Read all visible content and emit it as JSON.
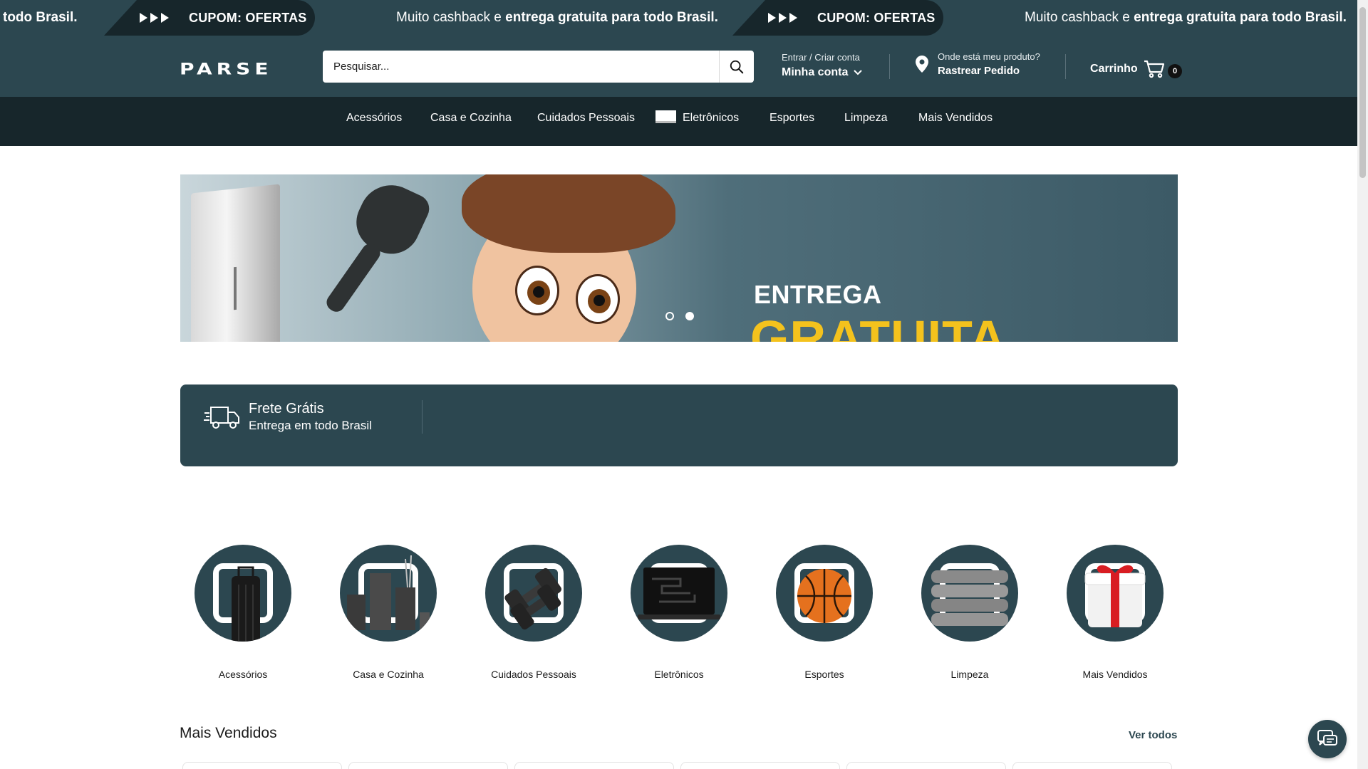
{
  "announcement": {
    "fragment_start": "todo Brasil.",
    "message_pre": "Muito cashback e ",
    "message_bold": "entrega gratuita para todo Brasil.",
    "coupon_label": "CUPOM: ",
    "coupon_code": "OFERTAS"
  },
  "header": {
    "logo": "PARSE",
    "search_placeholder": "Pesquisar...",
    "account_small": "Entrar / Criar conta",
    "account_big": "Minha conta",
    "track_small": "Onde está meu produto?",
    "track_big": "Rastrear Pedido",
    "cart_label": "Carrinho",
    "cart_count": "0"
  },
  "nav": [
    "Acessórios",
    "Casa e Cozinha",
    "Cuidados Pessoais",
    "Eletrônicos",
    "Esportes",
    "Limpeza",
    "Mais Vendidos"
  ],
  "hero": {
    "title_line1": "ENTREGA",
    "title_line2": "GRATUITA",
    "slides": 2,
    "active_slide": 2
  },
  "shipping": {
    "title": "Frete Grátis",
    "subtitle": "Entrega em todo Brasil"
  },
  "categories": [
    {
      "name": "Acessórios",
      "icon": "suitcase-icon"
    },
    {
      "name": "Casa e Cozinha",
      "icon": "bathroom-set-icon"
    },
    {
      "name": "Cuidados Pessoais",
      "icon": "dumbbell-icon"
    },
    {
      "name": "Eletrônicos",
      "icon": "laptop-icon"
    },
    {
      "name": "Esportes",
      "icon": "basketball-icon"
    },
    {
      "name": "Limpeza",
      "icon": "towels-icon"
    },
    {
      "name": "Mais Vendidos",
      "icon": "gift-icon"
    }
  ],
  "section": {
    "title": "Mais Vendidos",
    "link": "Ver todos"
  },
  "colors": {
    "primary": "#2c4750",
    "nav_dark": "#17262b",
    "accent_yellow": "#f4c21d"
  }
}
